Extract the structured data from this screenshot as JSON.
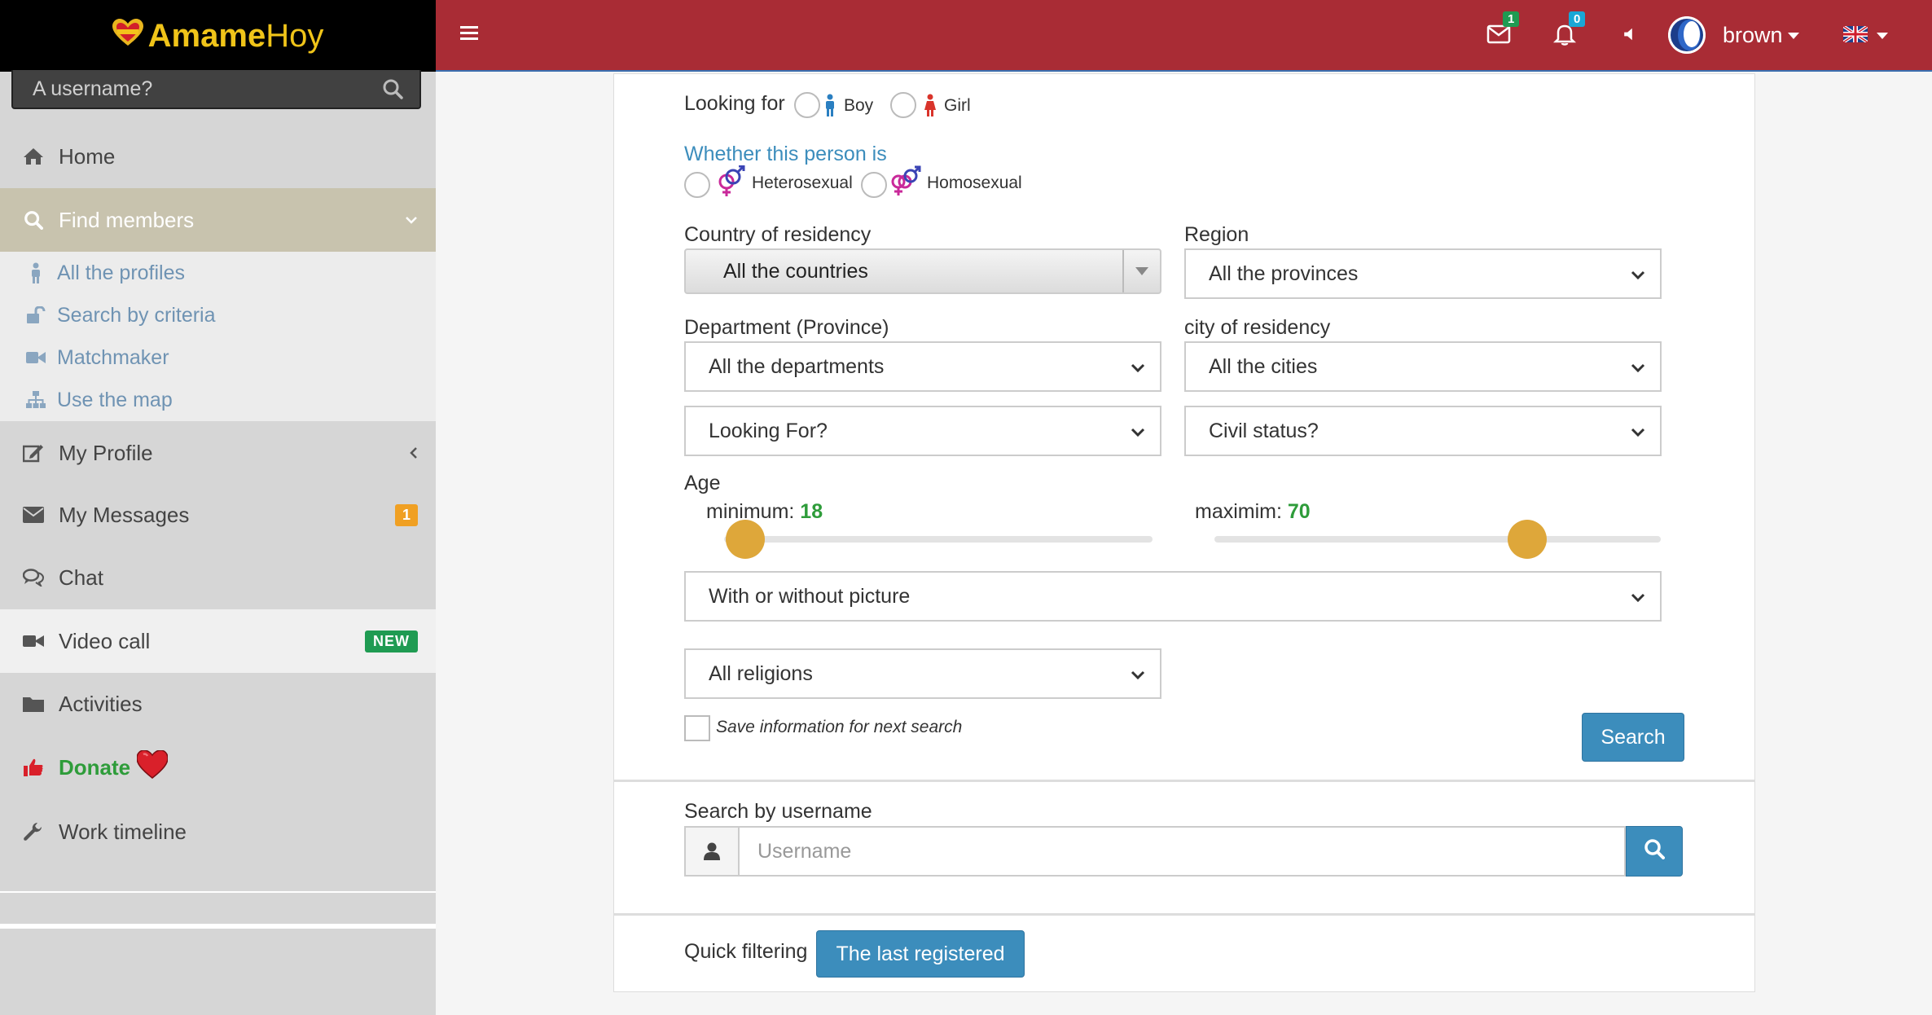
{
  "brand": {
    "name_bold": "Amame",
    "name_light": "Hoy"
  },
  "sidebar": {
    "search_placeholder": "A username?",
    "items": [
      {
        "label": "Home",
        "icon": "home-icon"
      },
      {
        "label": "Find members",
        "icon": "search-icon"
      },
      {
        "label": "My Profile",
        "icon": "edit-icon"
      },
      {
        "label": "My Messages",
        "icon": "envelope-icon",
        "badge": "1"
      },
      {
        "label": "Chat",
        "icon": "chat-icon"
      },
      {
        "label": "Video call",
        "icon": "video-icon",
        "badge": "NEW"
      },
      {
        "label": "Activities",
        "icon": "folder-icon"
      },
      {
        "label": "Donate",
        "icon": "thumbs-up-icon"
      },
      {
        "label": "Work timeline",
        "icon": "wrench-icon"
      }
    ],
    "subitems": [
      {
        "label": "All the profiles",
        "icon": "male-icon"
      },
      {
        "label": "Search by criteria",
        "icon": "unlock-icon"
      },
      {
        "label": "Matchmaker",
        "icon": "video-icon"
      },
      {
        "label": "Use the map",
        "icon": "sitemap-icon"
      }
    ]
  },
  "topbar": {
    "messages_count": "1",
    "notifications_count": "0",
    "username": "brown",
    "colors": {
      "bar": "#a92c35",
      "badge_green": "#1f9b52",
      "badge_blue": "#1aa7d6"
    }
  },
  "search_form": {
    "looking_for_label": "Looking for",
    "boy_label": "Boy",
    "girl_label": "Girl",
    "orientation_label": "Whether this person is",
    "hetero_label": "Heterosexual",
    "homo_label": "Homosexual",
    "country_label": "Country of residency",
    "country_value": "All the countries",
    "region_label": "Region",
    "region_value": "All the provinces",
    "department_label": "Department (Province)",
    "department_value": "All the departments",
    "city_label": "city of residency",
    "city_value": "All the cities",
    "looking_for_select": "Looking For?",
    "civil_status_select": "Civil status?",
    "age_label": "Age",
    "min_label": "minimum:",
    "min_value": "18",
    "max_label": "maximim:",
    "max_value": "70",
    "picture_select": "With or without picture",
    "religion_select": "All religions",
    "save_label": "Save information for next search",
    "search_button": "Search"
  },
  "username_search": {
    "label": "Search by username",
    "placeholder": "Username"
  },
  "quick_filter": {
    "label": "Quick filtering",
    "button": "The last registered"
  }
}
